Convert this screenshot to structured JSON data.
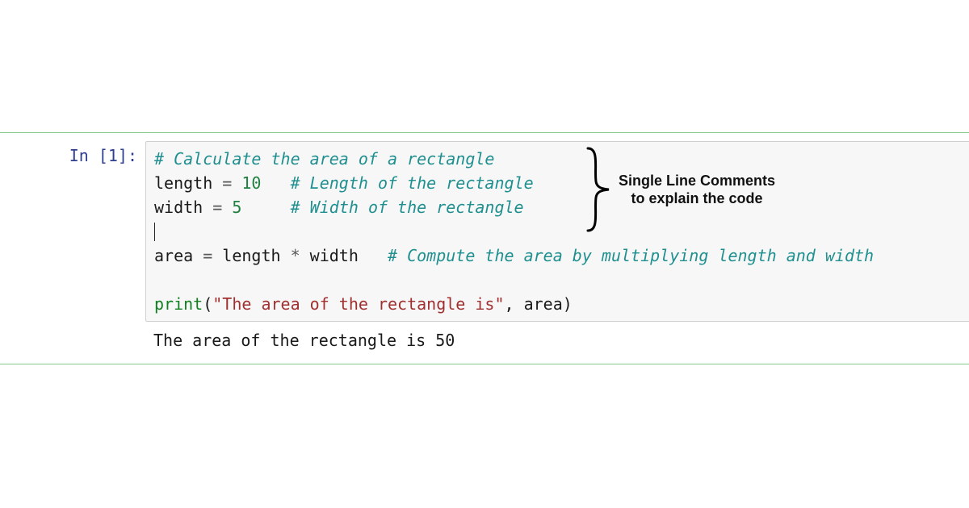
{
  "prompt": {
    "in_label": "In [1]:"
  },
  "code": {
    "line1_comment": "# Calculate the area of a rectangle",
    "line2_name": "length",
    "line2_eq": " = ",
    "line2_num": "10",
    "line2_space": "   ",
    "line2_comment": "# Length of the rectangle",
    "line3_name": "width",
    "line3_eq": " = ",
    "line3_num": "5",
    "line3_space": "     ",
    "line3_comment": "# Width of the rectangle",
    "line5_area": "area",
    "line5_eq": " = ",
    "line5_len": "length",
    "line5_mul": " * ",
    "line5_wid": "width",
    "line5_space": "   ",
    "line5_comment": "# Compute the area by multiplying length and width",
    "line6_print": "print",
    "line6_open": "(",
    "line6_str": "\"The area of the rectangle is\"",
    "line6_comma": ", ",
    "line6_arg": "area",
    "line6_close": ")"
  },
  "output": {
    "text": "The area of the rectangle is 50"
  },
  "annotation": {
    "line1": "Single Line Comments",
    "line2": "to explain the code"
  }
}
